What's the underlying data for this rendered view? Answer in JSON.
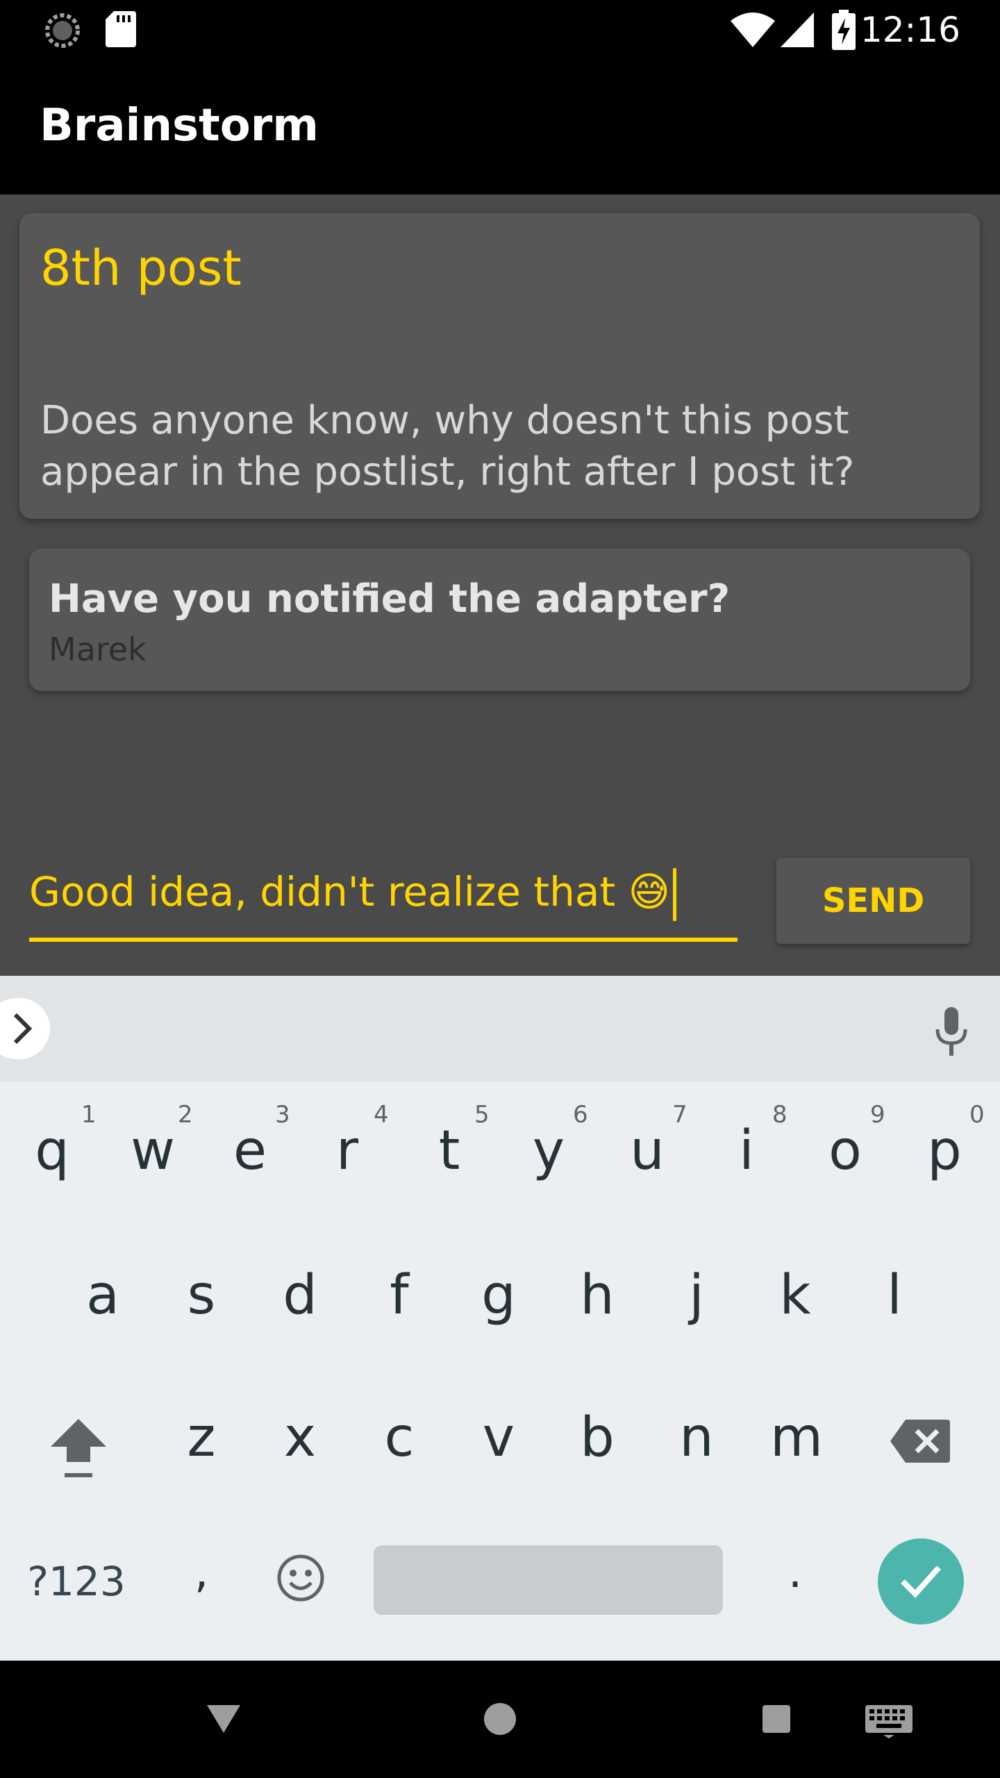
{
  "status_bar": {
    "time": "12:16"
  },
  "app_bar": {
    "title": "Brainstorm"
  },
  "post": {
    "title": "8th post",
    "body": "Does anyone know, why doesn't this post appear in the postlist, right after I post it?"
  },
  "comment": {
    "text": "Have you notified the adapter?",
    "author": "Marek"
  },
  "composer": {
    "value": "Good idea, didn't realize that 😅",
    "send_label": "SEND"
  },
  "keyboard": {
    "row1": [
      {
        "key": "q",
        "hint": "1"
      },
      {
        "key": "w",
        "hint": "2"
      },
      {
        "key": "e",
        "hint": "3"
      },
      {
        "key": "r",
        "hint": "4"
      },
      {
        "key": "t",
        "hint": "5"
      },
      {
        "key": "y",
        "hint": "6"
      },
      {
        "key": "u",
        "hint": "7"
      },
      {
        "key": "i",
        "hint": "8"
      },
      {
        "key": "o",
        "hint": "9"
      },
      {
        "key": "p",
        "hint": "0"
      }
    ],
    "row2": [
      "a",
      "s",
      "d",
      "f",
      "g",
      "h",
      "j",
      "k",
      "l"
    ],
    "row3": [
      "z",
      "x",
      "c",
      "v",
      "b",
      "n",
      "m"
    ],
    "symbols_label": "?123",
    "comma": ",",
    "period": "."
  },
  "colors": {
    "accent": "#ffd400",
    "background": "#4a4a4a",
    "card": "#575757",
    "enter": "#4db6ac"
  }
}
